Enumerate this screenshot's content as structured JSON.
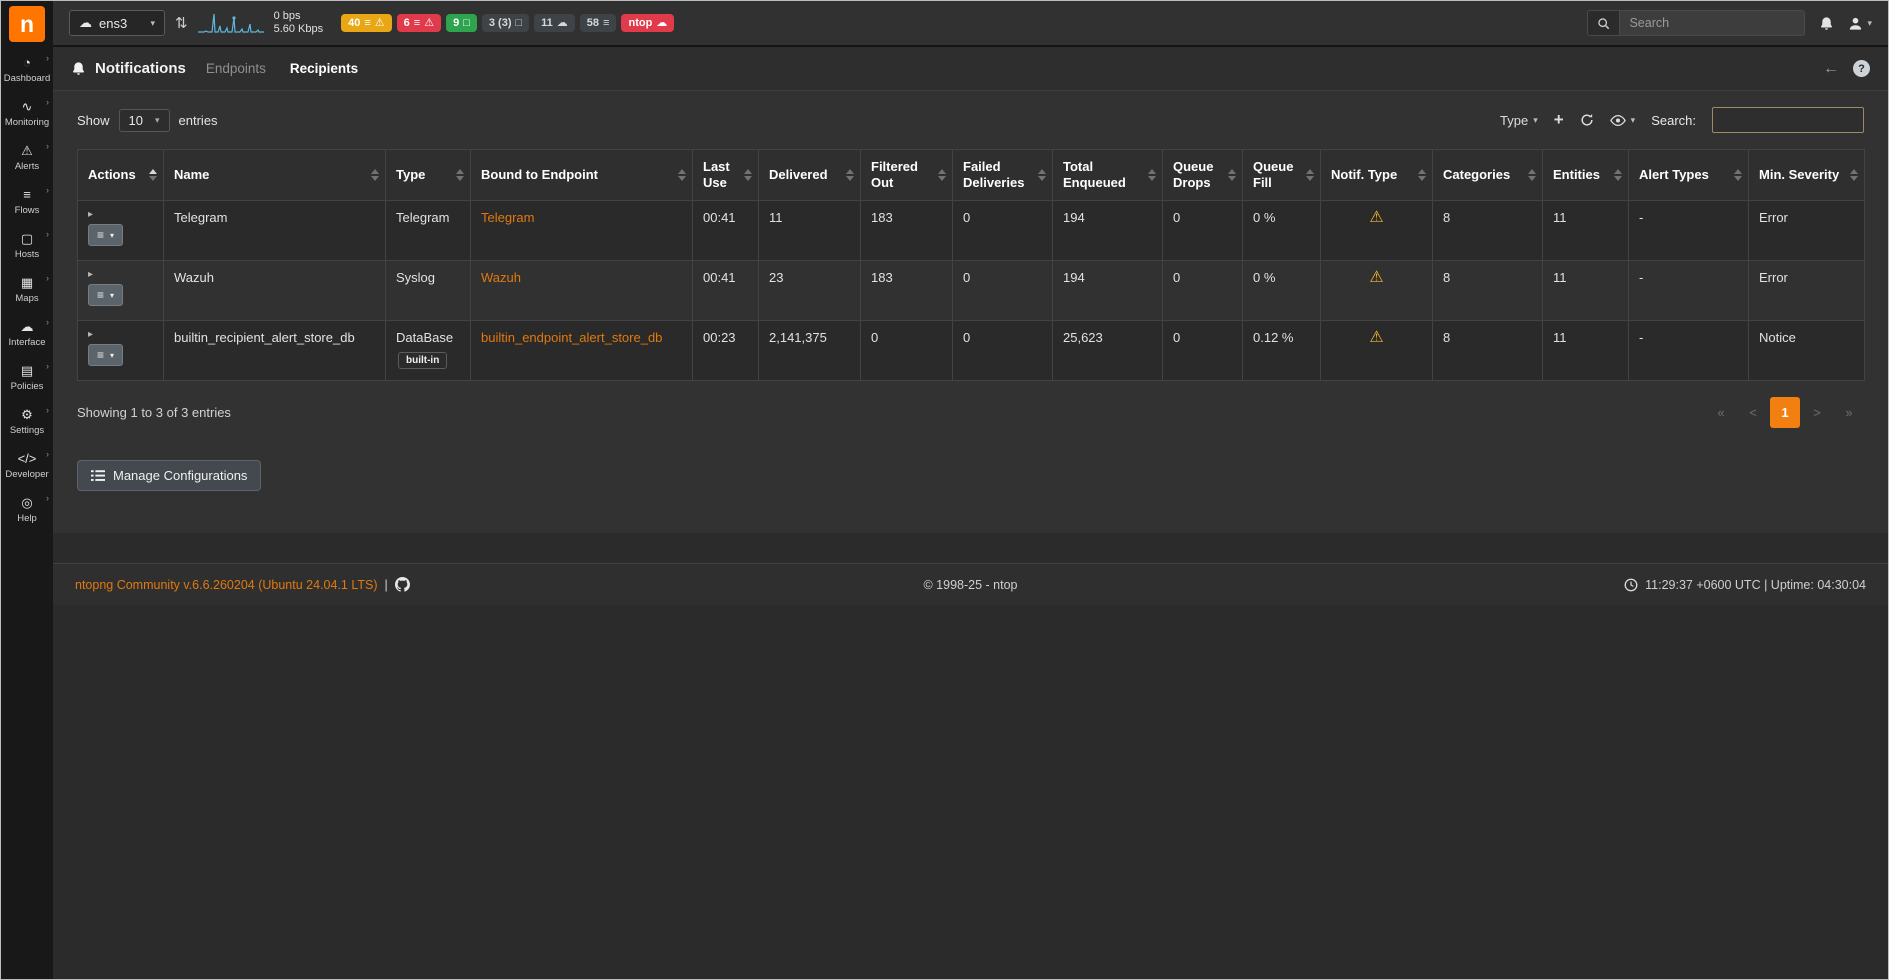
{
  "app": {
    "brand_letter": "n"
  },
  "glyphs": {
    "caret_down": "▾",
    "chevron_right": "›",
    "plus": "+",
    "expander": "▸",
    "menu": "≡",
    "updown": "⇅",
    "back_arrow": "←",
    "help": "?",
    "cloud": "☁"
  },
  "sidebar": {
    "items": [
      {
        "label": "Dashboard",
        "icon": "gauge-icon",
        "glyph": "◔"
      },
      {
        "label": "Monitoring",
        "icon": "waveform-icon",
        "glyph": "∿"
      },
      {
        "label": "Alerts",
        "icon": "warning-icon",
        "glyph": "⚠"
      },
      {
        "label": "Flows",
        "icon": "list-icon",
        "glyph": "≡"
      },
      {
        "label": "Hosts",
        "icon": "monitor-icon",
        "glyph": "▢"
      },
      {
        "label": "Maps",
        "icon": "map-icon",
        "glyph": "▦"
      },
      {
        "label": "Interface",
        "icon": "cloud-icon",
        "glyph": "☁"
      },
      {
        "label": "Policies",
        "icon": "policies-icon",
        "glyph": "▤"
      },
      {
        "label": "Settings",
        "icon": "gear-icon",
        "glyph": "⚙"
      },
      {
        "label": "Developer",
        "icon": "code-icon",
        "glyph": "</>"
      },
      {
        "label": "Help",
        "icon": "help-icon",
        "glyph": "◎"
      }
    ]
  },
  "topbar": {
    "interface": {
      "value": "ens3"
    },
    "traffic": {
      "up": "0 bps",
      "down": "5.60 Kbps"
    },
    "badges": [
      {
        "text": "40",
        "icons": [
          "≡",
          "⚠"
        ],
        "variant": "warning"
      },
      {
        "text": "6",
        "icons": [
          "≡",
          "⚠"
        ],
        "variant": "danger"
      },
      {
        "text": "9",
        "icons": [
          "□"
        ],
        "variant": "success"
      },
      {
        "text": "3 (3)",
        "icons": [
          "□"
        ],
        "variant": "secondary"
      },
      {
        "text": "11",
        "icons": [
          "☁"
        ],
        "variant": "secondary"
      },
      {
        "text": "58",
        "icons": [
          "≡"
        ],
        "variant": "secondary"
      },
      {
        "text": "ntop",
        "icons": [
          "☁"
        ],
        "variant": "danger"
      }
    ],
    "search": {
      "placeholder": "Search"
    }
  },
  "page": {
    "title": "Notifications",
    "tabs": [
      {
        "label": "Endpoints",
        "active": false
      },
      {
        "label": "Recipients",
        "active": true
      }
    ]
  },
  "toolbar": {
    "show_label": "Show",
    "page_size": "10",
    "entries_label": "entries",
    "type_label": "Type",
    "search_label": "Search:"
  },
  "table": {
    "columns": [
      {
        "label": "Actions"
      },
      {
        "label": "Name"
      },
      {
        "label": "Type"
      },
      {
        "label": "Bound to Endpoint"
      },
      {
        "label": "Last Use"
      },
      {
        "label": "Delivered"
      },
      {
        "label": "Filtered Out"
      },
      {
        "label": "Failed Deliveries"
      },
      {
        "label": "Total Enqueued"
      },
      {
        "label": "Queue Drops"
      },
      {
        "label": "Queue Fill"
      },
      {
        "label": "Notif. Type"
      },
      {
        "label": "Categories"
      },
      {
        "label": "Entities"
      },
      {
        "label": "Alert Types"
      },
      {
        "label": "Min. Severity"
      }
    ],
    "rows": [
      {
        "name": "Telegram",
        "type": "Telegram",
        "type_badge": "",
        "endpoint": "Telegram",
        "last_use": "00:41",
        "delivered": "11",
        "filtered_out": "183",
        "failed_deliveries": "0",
        "total_enqueued": "194",
        "queue_drops": "0",
        "queue_fill": "0 %",
        "notif_type": "⚠",
        "categories": "8",
        "entities": "11",
        "alert_types": "-",
        "min_severity": "Error"
      },
      {
        "name": "Wazuh",
        "type": "Syslog",
        "type_badge": "",
        "endpoint": "Wazuh",
        "last_use": "00:41",
        "delivered": "23",
        "filtered_out": "183",
        "failed_deliveries": "0",
        "total_enqueued": "194",
        "queue_drops": "0",
        "queue_fill": "0 %",
        "notif_type": "⚠",
        "categories": "8",
        "entities": "11",
        "alert_types": "-",
        "min_severity": "Error"
      },
      {
        "name": "builtin_recipient_alert_store_db",
        "type": "DataBase",
        "type_badge": "built-in",
        "endpoint": "builtin_endpoint_alert_store_db",
        "last_use": "00:23",
        "delivered": "2,141,375",
        "filtered_out": "0",
        "failed_deliveries": "0",
        "total_enqueued": "25,623",
        "queue_drops": "0",
        "queue_fill": "0.12 %",
        "notif_type": "⚠",
        "categories": "8",
        "entities": "11",
        "alert_types": "-",
        "min_severity": "Notice"
      }
    ]
  },
  "table_footer": {
    "summary": "Showing 1 to 3 of 3 entries",
    "pagination": [
      {
        "label": "«",
        "state": "disabled"
      },
      {
        "label": "<",
        "state": "disabled"
      },
      {
        "label": "1",
        "state": "active"
      },
      {
        "label": ">",
        "state": "disabled"
      },
      {
        "label": "»",
        "state": "disabled"
      }
    ]
  },
  "actions_cell": {
    "menu_glyph": "≡",
    "caret": "▾",
    "expander": "▸"
  },
  "manage_button": {
    "label": "Manage Configurations"
  },
  "footer": {
    "version_link": "ntopng Community v.6.6.260204 (Ubuntu 24.04.1 LTS)",
    "separator": "|",
    "copyright": "© 1998-25 - ntop",
    "clock": "11:29:37 +0600 UTC | Uptime: 04:30:04"
  },
  "colors": {
    "brand_orange": "#ff7500",
    "link_orange": "#e0790f",
    "active_page": "#f28011",
    "warning": "#f5b82e",
    "danger": "#e13b4b",
    "success": "#2ea44f"
  }
}
